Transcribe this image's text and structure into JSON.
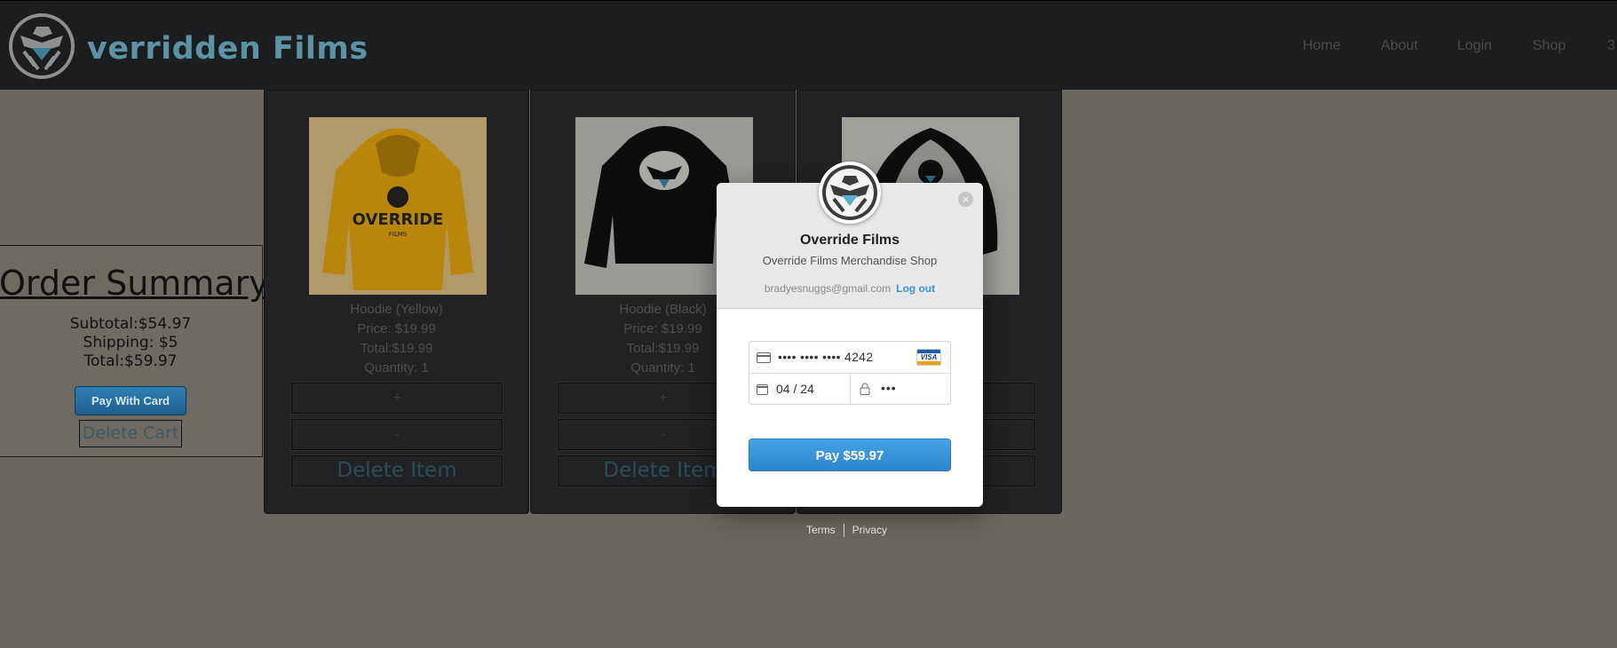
{
  "navbar": {
    "brand": "verridden Films",
    "links": [
      "Home",
      "About",
      "Login",
      "Shop",
      "3"
    ]
  },
  "order_summary": {
    "title": "Order Summary",
    "subtotal": "Subtotal:$54.97",
    "shipping": "Shipping: $5",
    "total": "Total:$59.97",
    "pay_button": "Pay With Card",
    "delete_cart_button": "Delete Cart"
  },
  "products": [
    {
      "name": "Hoodie (Yellow)",
      "price": "Price: $19.99",
      "total": "Total:$19.99",
      "quantity": "Quantity: 1",
      "image_text": "OVERRIDE",
      "image_sub": "FILMS",
      "plus": "+",
      "minus": "-",
      "delete": "Delete Item"
    },
    {
      "name": "Hoodie (Black)",
      "price": "Price: $19.99",
      "total": "Total:$19.99",
      "quantity": "Quantity: 1",
      "plus": "+",
      "minus": "-",
      "delete": "Delete Item"
    },
    {
      "name": "e)",
      "plus": "+",
      "minus": "-",
      "delete": "m"
    }
  ],
  "checkout": {
    "title": "Override Films",
    "subtitle": "Override Films Merchandise Shop",
    "email": "bradyesnuggs@gmail.com",
    "logout": "Log out",
    "close": "×",
    "card_number": "•••• •••• •••• 4242",
    "card_brand": "VISA",
    "expiry": "04 / 24",
    "cvc": "•••",
    "pay_button": "Pay $59.97"
  },
  "footer": {
    "terms": "Terms",
    "privacy": "Privacy"
  },
  "colors": {
    "overlay_bg": "#6b6760",
    "navbar_bg": "#1c1d1f",
    "brand": "#5b93a3",
    "pay_blue": "#3a96dd",
    "card_bg": "#222224"
  }
}
